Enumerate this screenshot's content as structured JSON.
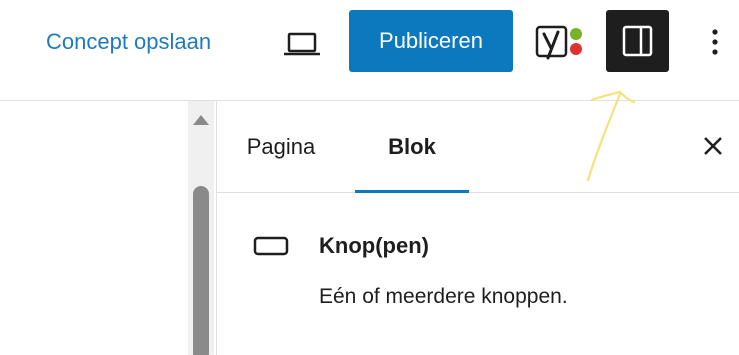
{
  "toolbar": {
    "save_draft_label": "Concept opslaan",
    "preview_icon": "desktop-preview-icon",
    "publish_label": "Publiceren",
    "yoast_icon": "yoast-seo-icon",
    "sidebar_toggle_icon": "sidebar-panel-icon",
    "options_icon": "vertical-ellipsis-icon"
  },
  "sidebar": {
    "tabs": [
      {
        "label": "Pagina",
        "active": false
      },
      {
        "label": "Blok",
        "active": true
      }
    ],
    "close_icon": "close-icon",
    "block": {
      "icon": "buttons-block-icon",
      "title": "Knop(pen)",
      "description": "Eén of meerdere knoppen."
    }
  },
  "colors": {
    "accent": "#0c78bd",
    "link": "#1e7bc0",
    "dark": "#1e1e1e",
    "annotation": "#f4e27a",
    "yoast_green": "#77b227",
    "yoast_red": "#dc3232"
  }
}
